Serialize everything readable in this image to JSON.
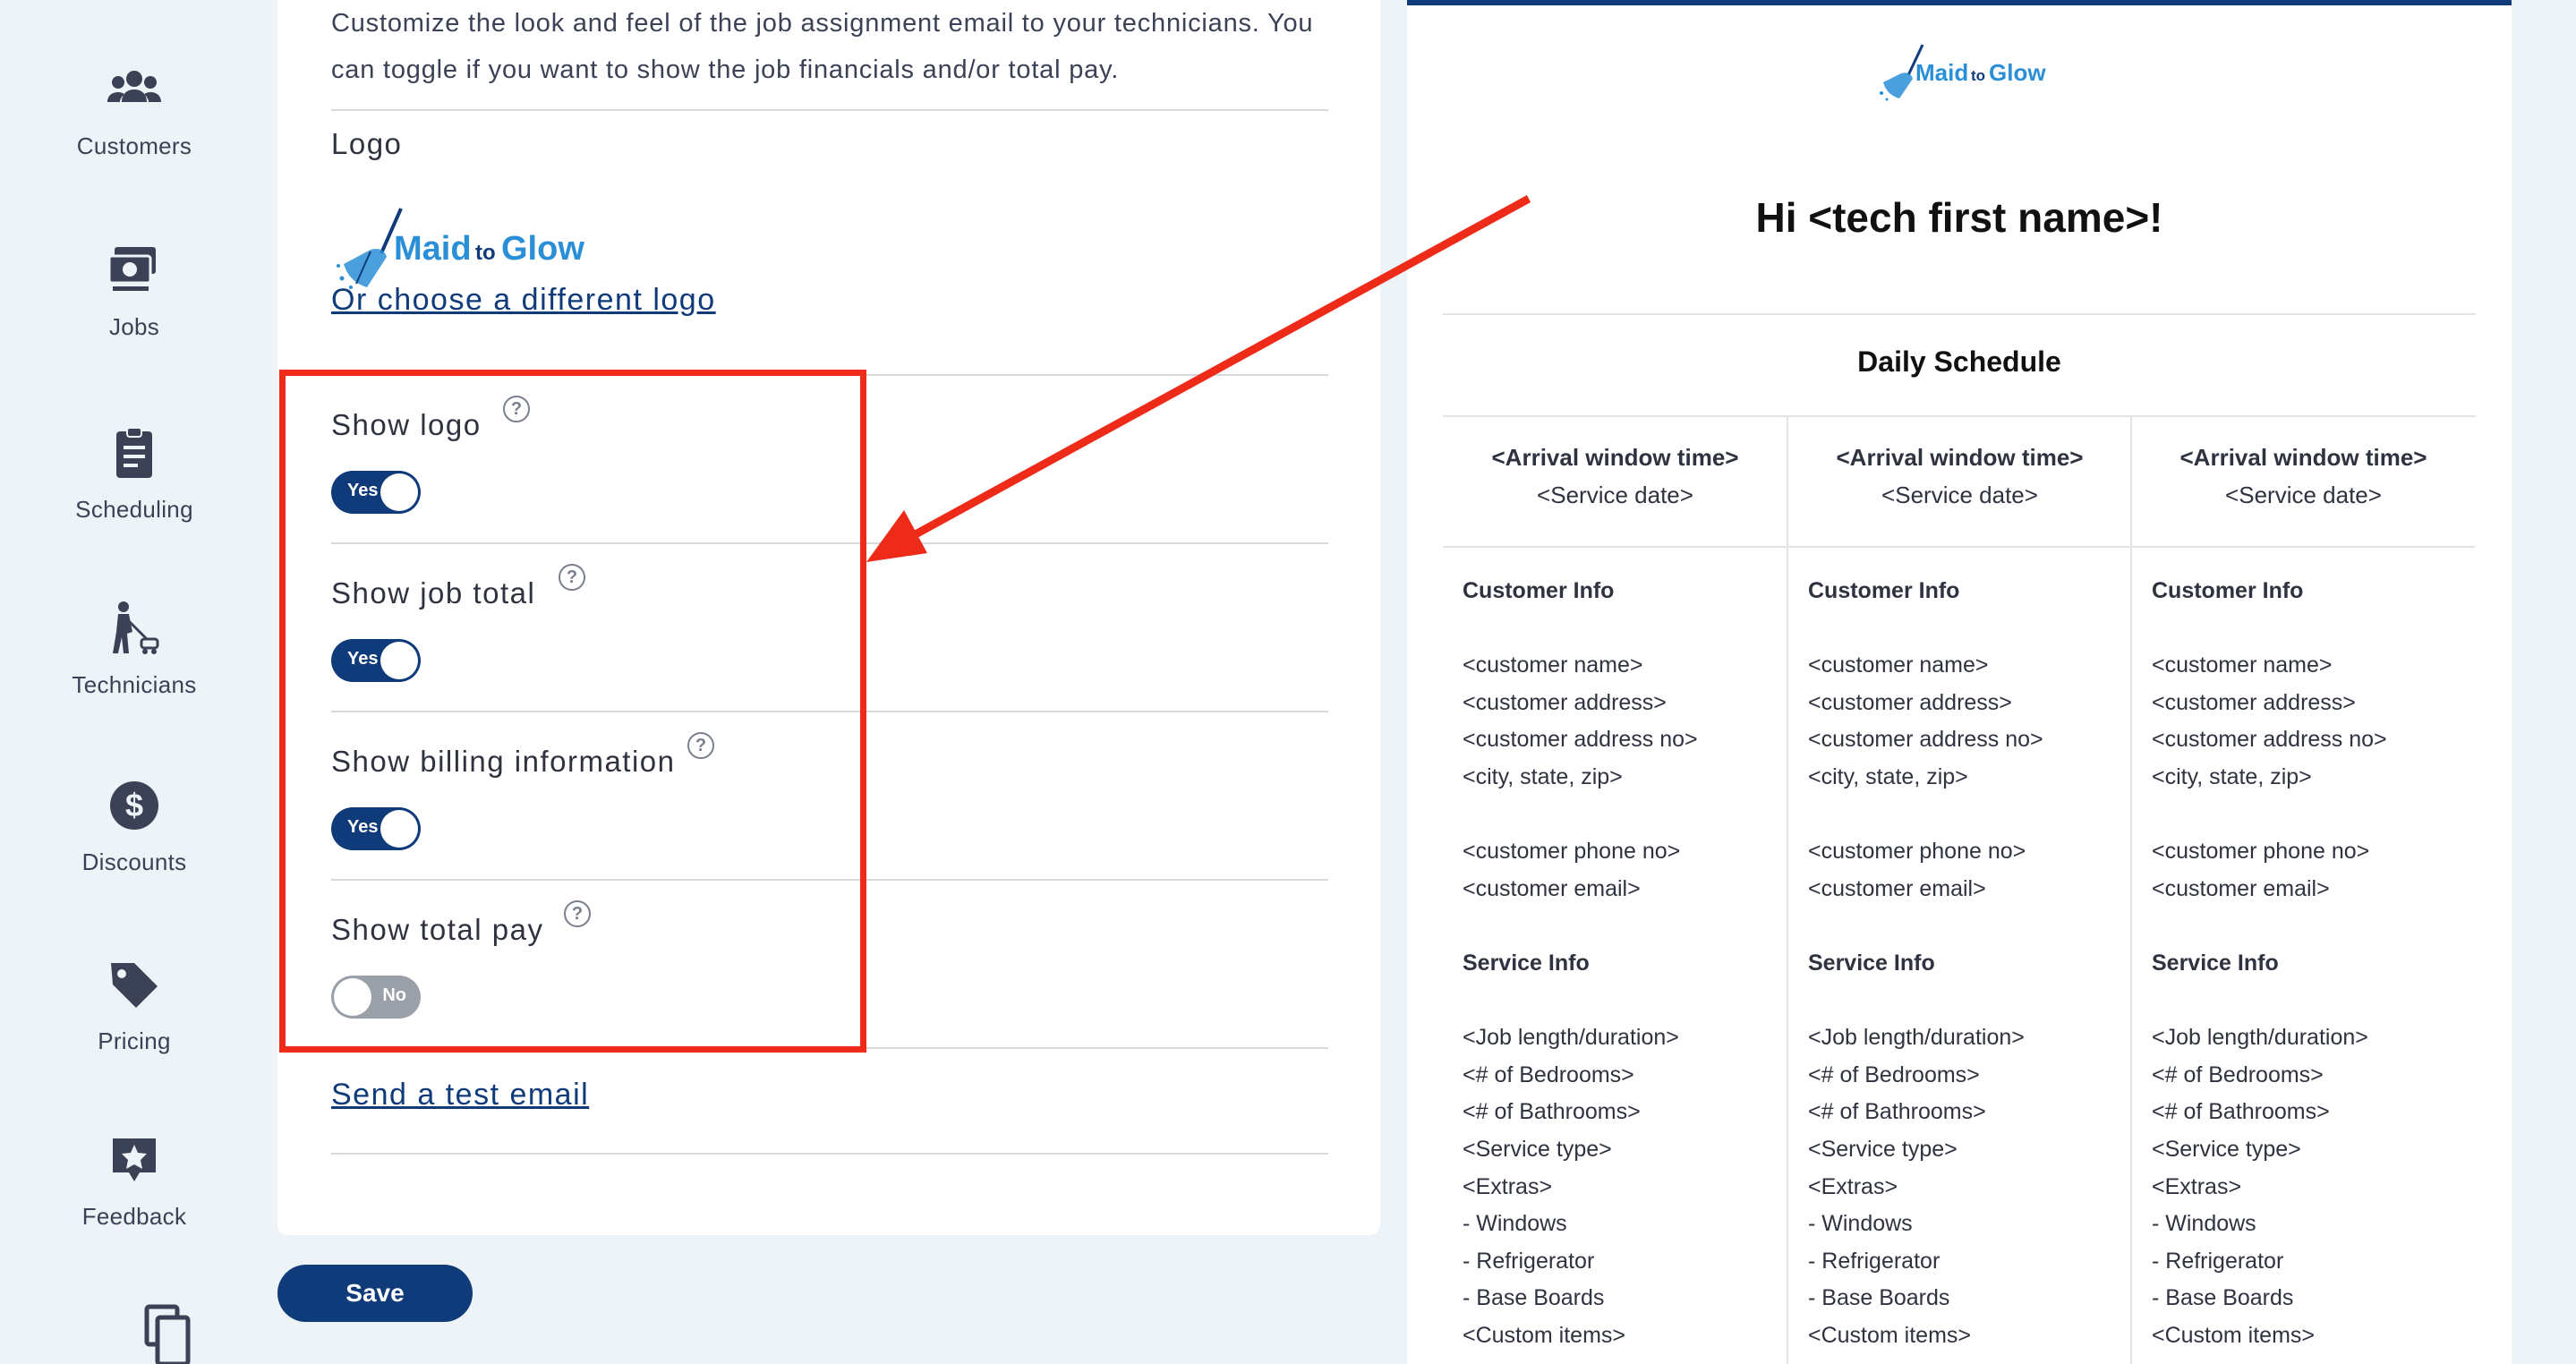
{
  "sidebar": {
    "items": [
      {
        "label": "Customers",
        "icon": "users-icon"
      },
      {
        "label": "Jobs",
        "icon": "jobs-icon"
      },
      {
        "label": "Scheduling",
        "icon": "clipboard-icon"
      },
      {
        "label": "Technicians",
        "icon": "technician-icon"
      },
      {
        "label": "Discounts",
        "icon": "dollar-circle-icon"
      },
      {
        "label": "Pricing",
        "icon": "price-tag-icon"
      },
      {
        "label": "Feedback",
        "icon": "feedback-star-icon"
      }
    ]
  },
  "settings": {
    "intro_line1": "Customize the look and feel of the job assignment email to your technicians. You",
    "intro_line2": "can toggle if you want to show the job financials and/or total pay.",
    "logo_label": "Logo",
    "brand": {
      "maid": "Maid",
      "to": "to",
      "glow": "Glow"
    },
    "choose_logo_link": "Or choose a different logo",
    "help_glyph": "?",
    "toggles": [
      {
        "label": "Show logo",
        "state": "Yes",
        "on": true
      },
      {
        "label": "Show job total",
        "state": "Yes",
        "on": true
      },
      {
        "label": "Show billing information",
        "state": "Yes",
        "on": true
      },
      {
        "label": "Show total pay",
        "state": "No",
        "on": false
      }
    ],
    "test_email_link": "Send a test email",
    "save_label": "Save"
  },
  "preview": {
    "greeting": "Hi <tech first name>!",
    "subtitle": "Daily Schedule",
    "column": {
      "arrival": "<Arrival window time>",
      "service_date": "<Service date>",
      "customer_header": "Customer Info",
      "customer_lines": [
        "<customer name>",
        "<customer address>",
        "<customer address no>",
        "<city, state, zip>"
      ],
      "contact_lines": [
        "<customer phone no>",
        "<customer email>"
      ],
      "service_header": "Service Info",
      "service_lines": [
        "<Job length/duration>",
        "<# of Bedrooms>",
        "<# of Bathrooms>",
        "<Service type>",
        "<Extras>",
        "- Windows",
        "- Refrigerator",
        "- Base Boards",
        "<Custom items>"
      ]
    }
  },
  "colors": {
    "primary": "#0f3b7a",
    "annotation": "#ee2a18",
    "brand_blue": "#2a8fd6",
    "toggle_off": "#9aa0a8"
  }
}
